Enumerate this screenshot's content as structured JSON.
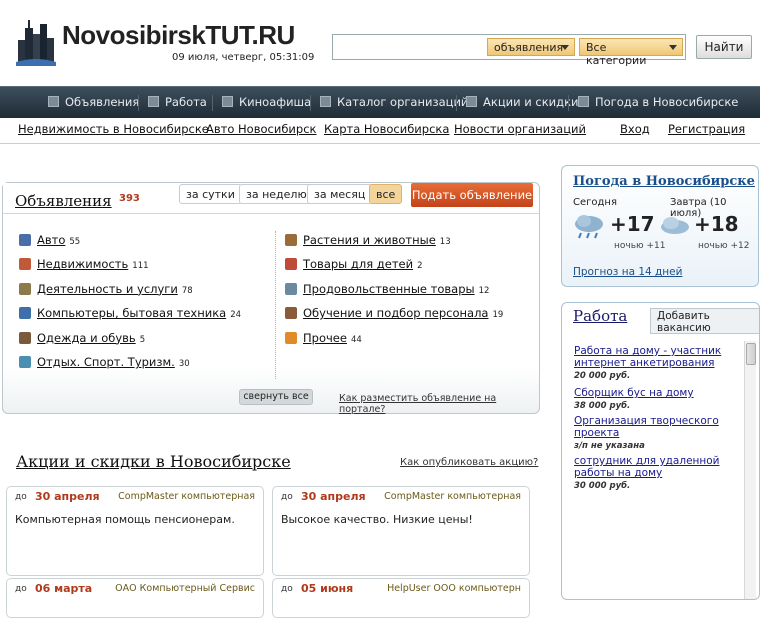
{
  "header": {
    "logo_text": "NovosibirskTUT.RU",
    "datetime": "09 июля, четверг, 05:31:09",
    "search": {
      "value": "",
      "placeholder": ""
    },
    "dropdown_type": "объявления",
    "dropdown_category": "Все категории",
    "find_label": "Найти"
  },
  "mainnav": [
    {
      "label": "Объявления"
    },
    {
      "label": "Работа"
    },
    {
      "label": "Киноафиша"
    },
    {
      "label": "Каталог организаций"
    },
    {
      "label": "Акции и скидки"
    },
    {
      "label": "Погода в Новосибирске"
    }
  ],
  "subnav": [
    {
      "label": "Недвижимость в Новосибирске"
    },
    {
      "label": "Авто Новосибирск"
    },
    {
      "label": "Карта Новосибирска"
    },
    {
      "label": "Новости организаций"
    },
    {
      "label": "Вход"
    },
    {
      "label": "Регистрация"
    }
  ],
  "ads": {
    "title": "Объявления",
    "count": "393",
    "periods": [
      "за сутки",
      "за неделю",
      "за месяц",
      "все"
    ],
    "active_period": "все",
    "post_button": "Подать объявление",
    "left": [
      {
        "name": "Авто",
        "count": "55",
        "icon": "car-icon",
        "color": "#4a6fa8"
      },
      {
        "name": "Недвижимость",
        "count": "111",
        "icon": "house-icon",
        "color": "#c0583a"
      },
      {
        "name": "Деятельность и услуги",
        "count": "78",
        "icon": "glasses-icon",
        "color": "#8c7a4a"
      },
      {
        "name": "Компьютеры, бытовая техника",
        "count": "24",
        "icon": "computer-icon",
        "color": "#3d6fa8"
      },
      {
        "name": "Одежда и обувь",
        "count": "5",
        "icon": "clothes-icon",
        "color": "#7a5a3a"
      },
      {
        "name": "Отдых. Спорт. Туризм.",
        "count": "30",
        "icon": "travel-icon",
        "color": "#4a8fb0"
      }
    ],
    "right": [
      {
        "name": "Растения и животные",
        "count": "13",
        "icon": "pet-icon",
        "color": "#9a6a3a"
      },
      {
        "name": "Товары для детей",
        "count": "2",
        "icon": "toy-icon",
        "color": "#c04a3a"
      },
      {
        "name": "Продовольственные товары",
        "count": "12",
        "icon": "food-icon",
        "color": "#6a8aa0"
      },
      {
        "name": "Обучение и подбор персонала",
        "count": "19",
        "icon": "people-icon",
        "color": "#8a5a3a"
      },
      {
        "name": "Прочее",
        "count": "44",
        "icon": "flower-icon",
        "color": "#e08a2a"
      }
    ],
    "collapse_label": "свернуть все",
    "howto_label": "Как разместить объявление на портале?"
  },
  "promos": {
    "title": "Акции и скидки в Новосибирске",
    "howto": "Как опубликовать акцию?",
    "cards": [
      {
        "do": "до",
        "date": "30 апреля",
        "company": "CompMaster компьютерная",
        "text": "Компьютерная помощь пенсионерам."
      },
      {
        "do": "до",
        "date": "30 апреля",
        "company": "CompMaster компьютерная",
        "text": "Высокое качество. Низкие цены!"
      },
      {
        "do": "до",
        "date": "06 марта",
        "company": "ОАО Компьютерный Сервис",
        "text": ""
      },
      {
        "do": "до",
        "date": "05 июня",
        "company": "HelpUser ООО компьютерн",
        "text": ""
      }
    ]
  },
  "weather": {
    "title": "Погода в Новосибирске",
    "today_label": "Сегодня",
    "tomorrow_label": "Завтра (10 июля)",
    "today_temp": "+17",
    "today_night": "ночью +11",
    "tomorrow_temp": "+18",
    "tomorrow_night": "ночью +12",
    "forecast_link": "Прогноз на 14 дней"
  },
  "jobs": {
    "title": "Работа",
    "add_button": "Добавить вакансию",
    "items": [
      {
        "title": "Работа на дому - участник интернет анкетирования",
        "salary": "20 000 руб."
      },
      {
        "title": "Сборщик бус на дому",
        "salary": "38 000 руб."
      },
      {
        "title": "Организация творческого проекта",
        "salary": "з/п не указана"
      },
      {
        "title": "сотрудник для удаленной работы на дому",
        "salary": "30 000 руб."
      }
    ]
  }
}
